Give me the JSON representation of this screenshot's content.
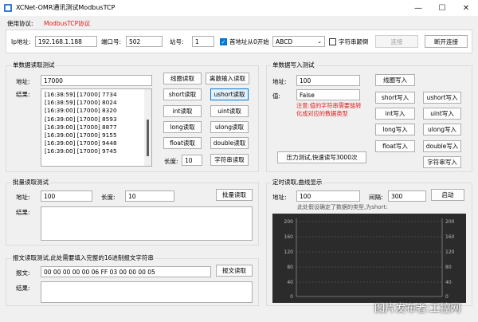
{
  "window": {
    "title": "XCNet-OMR通讯测试ModbusTCP",
    "minimize": "—",
    "maximize": "☐",
    "close": "✕"
  },
  "protocol": {
    "label": "使用协议:",
    "value": "ModbusTCP协议"
  },
  "connection": {
    "ip_label": "Ip地址:",
    "ip_value": "192.168.1.188",
    "port_label": "端口号:",
    "port_value": "502",
    "station_label": "站号:",
    "station_value": "1",
    "addr_from_zero_label": "首地址从0开始",
    "byte_order_value": "ABCD",
    "string_reverse_label": "字符串颠倒",
    "connect_label": "连接",
    "disconnect_label": "断开连接"
  },
  "single_read": {
    "title": "单数据读取测试",
    "address_label": "地址:",
    "address_value": "17000",
    "result_label": "结果:",
    "results": [
      "[16:38:59] [17000] 7734",
      "[16:38:59] [17000] 8024",
      "[16:39:00] [17000] 8320",
      "[16:39:00] [17000] 8593",
      "[16:39:00] [17000] 8877",
      "[16:39:00] [17000] 9155",
      "[16:39:00] [17000] 9448",
      "[16:39:00] [17000] 9745"
    ],
    "buttons": {
      "coil_read": "线圈读取",
      "discrete_read": "离散输入读取",
      "short_read": "short读取",
      "ushort_read": "ushort读取",
      "int_read": "int读取",
      "uint_read": "uint读取",
      "long_read": "long读取",
      "ulong_read": "ulong读取",
      "float_read": "float读取",
      "double_read": "double读取",
      "string_read": "字符串读取"
    },
    "length_label": "长度:",
    "length_value": "10"
  },
  "single_write": {
    "title": "单数据写入测试",
    "address_label": "地址:",
    "address_value": "100",
    "value_label": "值:",
    "value_value": "False",
    "note": "注意:值的字符串需要能转化成对应的数据类型",
    "buttons": {
      "coil_write": "线圈写入",
      "short_write": "short写入",
      "ushort_write": "ushort写入",
      "int_write": "int写入",
      "uint_write": "uint写入",
      "long_write": "long写入",
      "ulong_write": "ulong写入",
      "float_write": "float写入",
      "double_write": "double写入",
      "string_write": "字符串写入"
    },
    "stress_test_label": "压力测试,快速读写3000次"
  },
  "batch_read": {
    "title": "批量读取测试",
    "address_label": "地址:",
    "address_value": "100",
    "length_label": "长度:",
    "length_value": "10",
    "button_label": "批量读取",
    "result_label": "结果:"
  },
  "timed_read": {
    "title": "定时读取,曲线显示",
    "address_label": "地址:",
    "address_value": "100",
    "interval_label": "间隔:",
    "interval_value": "300",
    "start_label": "启动",
    "hint": "此处假设确定了数据的类型,为short:",
    "y_ticks_left": [
      "200",
      "160",
      "120",
      "80",
      "40",
      "0"
    ],
    "y_ticks_right": [
      "200",
      "160",
      "120",
      "80",
      "40",
      "0"
    ]
  },
  "message_read": {
    "title": "报文读取测试,此处需要填入完整的16进制报文字符串",
    "message_label": "报文:",
    "message_value": "00 00 00 00 00 06 FF 03 00 00 00 05",
    "button_label": "报文读取",
    "result_label": "结果:"
  },
  "watermark": "图片发布者:工控网",
  "colors": {
    "accent": "#0078d7",
    "protocol_red": "#e21a1a",
    "chart_bg": "#2b2b2b"
  }
}
